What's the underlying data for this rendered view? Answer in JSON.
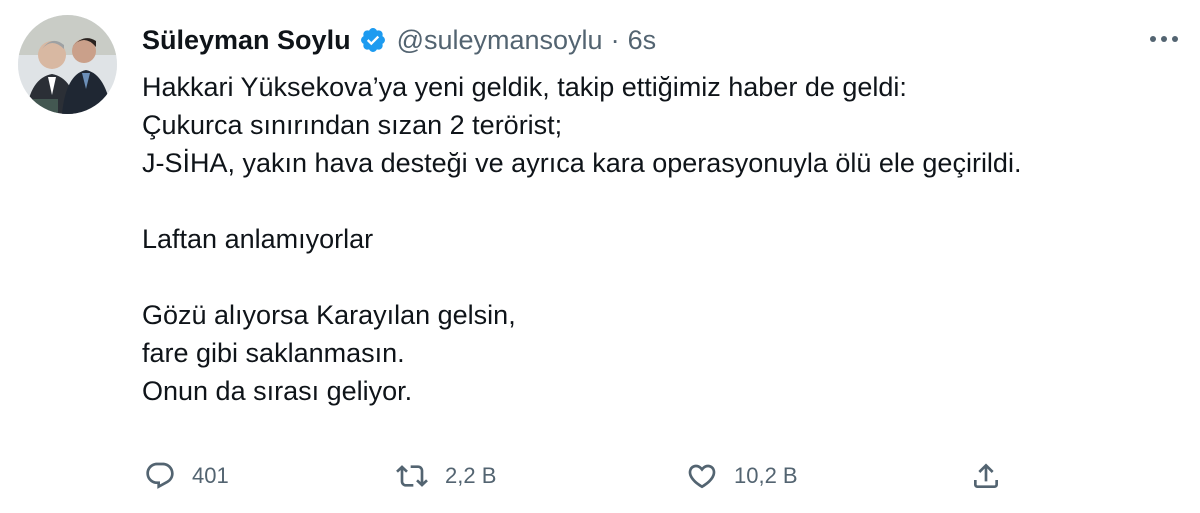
{
  "tweet": {
    "author": {
      "display_name": "Süleyman Soylu",
      "handle": "@suleymansoylu",
      "verified": true
    },
    "separator": "·",
    "time": "6s",
    "text_lines": [
      "Hakkari Yüksekova’ya yeni geldik, takip ettiğimiz haber de geldi:",
      "Çukurca sınırından sızan 2 terörist;",
      "J-SİHA, yakın hava desteği ve ayrıca kara operasyonuyla ölü ele geçirildi.",
      "",
      "Laftan anlamıyorlar",
      "",
      "Gözü alıyorsa Karayılan gelsin,",
      "fare gibi saklanmasın.",
      "Onun da sırası geliyor."
    ],
    "actions": {
      "reply": {
        "icon": "reply-icon",
        "count": "401"
      },
      "retweet": {
        "icon": "retweet-icon",
        "count": "2,2 B"
      },
      "like": {
        "icon": "heart-icon",
        "count": "10,2 B"
      },
      "share": {
        "icon": "share-icon"
      }
    }
  },
  "colors": {
    "text": "#0f1419",
    "secondary": "#536471",
    "verified_badge": "#1d9bf0"
  }
}
